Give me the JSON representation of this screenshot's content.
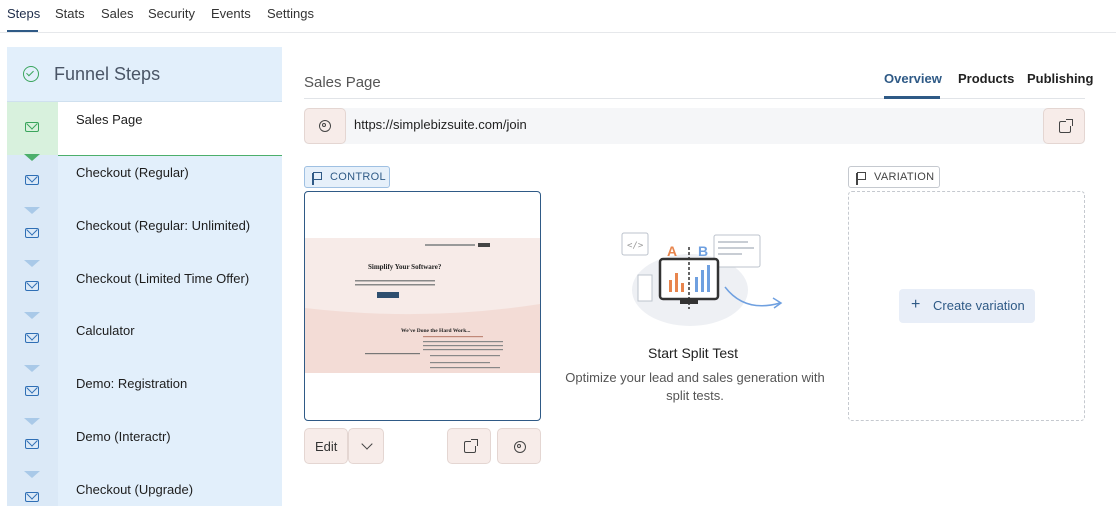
{
  "top_tabs": [
    "Steps",
    "Stats",
    "Sales",
    "Security",
    "Events",
    "Settings"
  ],
  "sidebar": {
    "title": "Funnel Steps",
    "steps": [
      "Sales Page",
      "Checkout (Regular)",
      "Checkout (Regular: Unlimited)",
      "Checkout (Limited Time Offer)",
      "Calculator",
      "Demo: Registration",
      "Demo (Interactr)",
      "Checkout (Upgrade)"
    ]
  },
  "main": {
    "title": "Sales Page",
    "tabs": [
      "Overview",
      "Products",
      "Publishing"
    ],
    "url": "https://simplebizsuite.com/join"
  },
  "control": {
    "tag": "CONTROL",
    "edit_label": "Edit",
    "preview": {
      "headline": "Simplify Your Software?",
      "subheadline": "We've Done the Hard Work..."
    }
  },
  "variation": {
    "tag": "VARIATION",
    "create_label": "Create variation"
  },
  "split": {
    "title": "Start Split Test",
    "description": "Optimize your lead and sales generation with split tests.",
    "illustration": {
      "letter_a": "A",
      "letter_b": "B"
    }
  },
  "colors": {
    "accent": "#2f5a86",
    "sidebar_bg": "#e2effb",
    "active_step": "#4caf6b",
    "button_bg": "#f7ece9"
  },
  "icons": [
    "check-circle-icon",
    "mail-icon",
    "gear-icon",
    "external-link-icon",
    "flag-icon",
    "plus-icon",
    "chevron-down-icon"
  ]
}
